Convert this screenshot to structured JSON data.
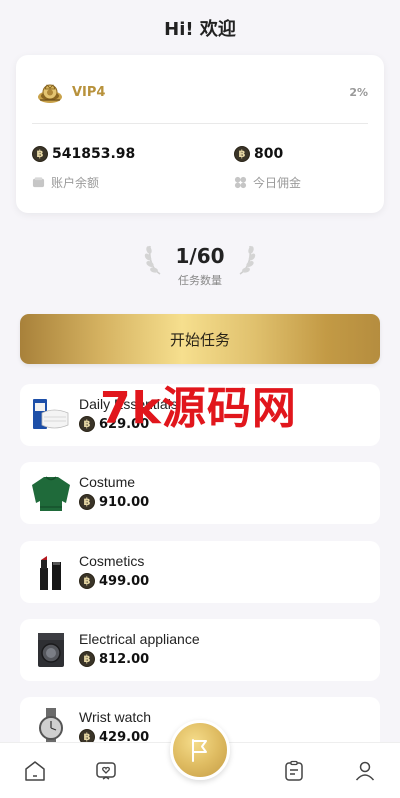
{
  "header": {
    "title": "Hi! 欢迎"
  },
  "vip": {
    "level": "VIP4",
    "rate": "2%",
    "balance": "541853.98",
    "balance_label": "账户余额",
    "commission": "800",
    "commission_label": "今日佣金",
    "coin_symbol": "฿"
  },
  "tasks": {
    "count": "1/60",
    "label": "任务数量"
  },
  "start_button": {
    "label": "开始任务"
  },
  "watermark": "7k源码网",
  "products": [
    {
      "name": "Daily Essentials",
      "price": "629.00",
      "icon": "mask-box-icon"
    },
    {
      "name": "Costume",
      "price": "910.00",
      "icon": "sweater-icon"
    },
    {
      "name": "Cosmetics",
      "price": "499.00",
      "icon": "lipstick-icon"
    },
    {
      "name": "Electrical appliance",
      "price": "812.00",
      "icon": "washing-machine-icon"
    },
    {
      "name": "Wrist watch",
      "price": "429.00",
      "icon": "wristwatch-icon"
    }
  ],
  "colors": {
    "gold": "#d4b160",
    "vip_text": "#b8923c",
    "watermark": "#e1161c"
  }
}
